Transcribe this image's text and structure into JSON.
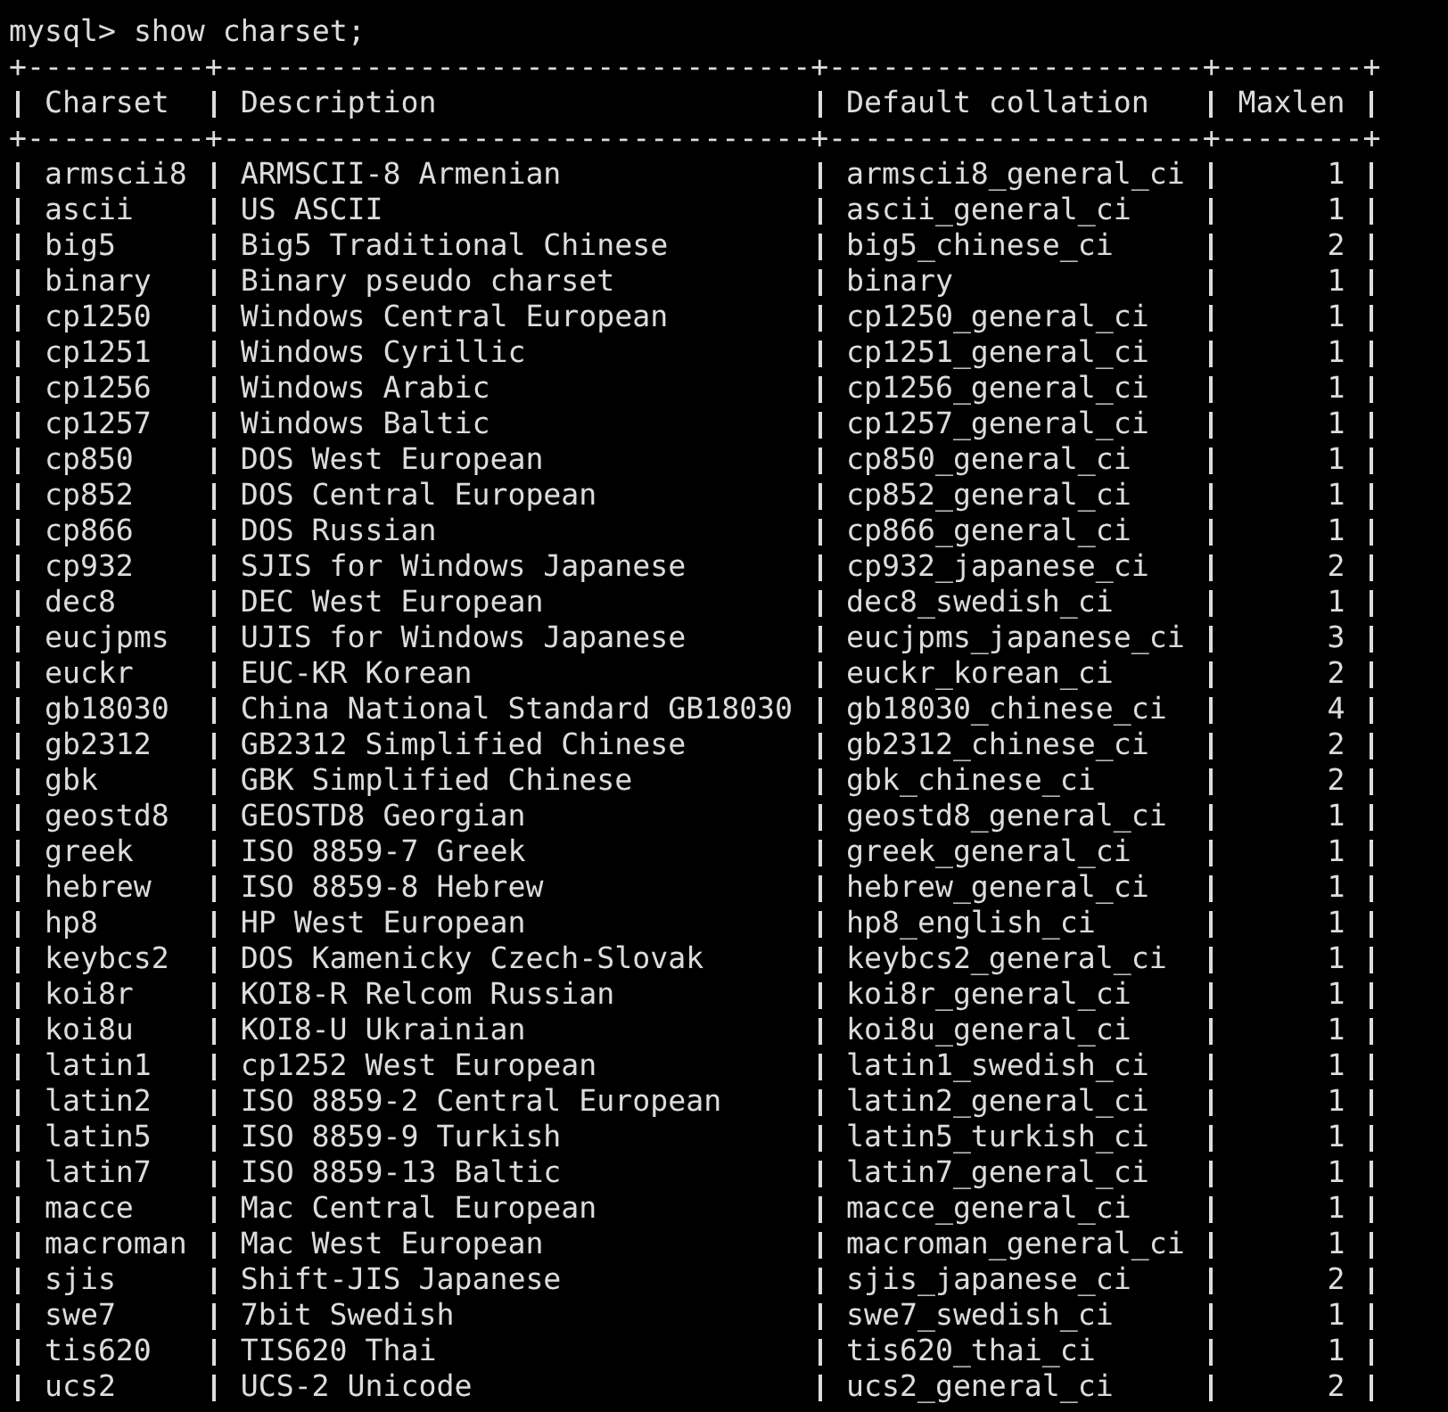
{
  "terminal": {
    "prompt": "mysql>",
    "command": "show charset;",
    "rule_top": "+----------+---------------------------------+---------------------+--------+",
    "rule_header": "+----------+---------------------------------+---------------------+--------+",
    "columns": [
      "Charset",
      "Description",
      "Default collation",
      "Maxlen"
    ],
    "rows": [
      {
        "charset": "armscii8",
        "description": "ARMSCII-8 Armenian",
        "default_collation": "armscii8_general_ci",
        "maxlen": "1"
      },
      {
        "charset": "ascii",
        "description": "US ASCII",
        "default_collation": "ascii_general_ci",
        "maxlen": "1"
      },
      {
        "charset": "big5",
        "description": "Big5 Traditional Chinese",
        "default_collation": "big5_chinese_ci",
        "maxlen": "2"
      },
      {
        "charset": "binary",
        "description": "Binary pseudo charset",
        "default_collation": "binary",
        "maxlen": "1"
      },
      {
        "charset": "cp1250",
        "description": "Windows Central European",
        "default_collation": "cp1250_general_ci",
        "maxlen": "1"
      },
      {
        "charset": "cp1251",
        "description": "Windows Cyrillic",
        "default_collation": "cp1251_general_ci",
        "maxlen": "1"
      },
      {
        "charset": "cp1256",
        "description": "Windows Arabic",
        "default_collation": "cp1256_general_ci",
        "maxlen": "1"
      },
      {
        "charset": "cp1257",
        "description": "Windows Baltic",
        "default_collation": "cp1257_general_ci",
        "maxlen": "1"
      },
      {
        "charset": "cp850",
        "description": "DOS West European",
        "default_collation": "cp850_general_ci",
        "maxlen": "1"
      },
      {
        "charset": "cp852",
        "description": "DOS Central European",
        "default_collation": "cp852_general_ci",
        "maxlen": "1"
      },
      {
        "charset": "cp866",
        "description": "DOS Russian",
        "default_collation": "cp866_general_ci",
        "maxlen": "1"
      },
      {
        "charset": "cp932",
        "description": "SJIS for Windows Japanese",
        "default_collation": "cp932_japanese_ci",
        "maxlen": "2"
      },
      {
        "charset": "dec8",
        "description": "DEC West European",
        "default_collation": "dec8_swedish_ci",
        "maxlen": "1"
      },
      {
        "charset": "eucjpms",
        "description": "UJIS for Windows Japanese",
        "default_collation": "eucjpms_japanese_ci",
        "maxlen": "3"
      },
      {
        "charset": "euckr",
        "description": "EUC-KR Korean",
        "default_collation": "euckr_korean_ci",
        "maxlen": "2"
      },
      {
        "charset": "gb18030",
        "description": "China National Standard GB18030",
        "default_collation": "gb18030_chinese_ci",
        "maxlen": "4"
      },
      {
        "charset": "gb2312",
        "description": "GB2312 Simplified Chinese",
        "default_collation": "gb2312_chinese_ci",
        "maxlen": "2"
      },
      {
        "charset": "gbk",
        "description": "GBK Simplified Chinese",
        "default_collation": "gbk_chinese_ci",
        "maxlen": "2"
      },
      {
        "charset": "geostd8",
        "description": "GEOSTD8 Georgian",
        "default_collation": "geostd8_general_ci",
        "maxlen": "1"
      },
      {
        "charset": "greek",
        "description": "ISO 8859-7 Greek",
        "default_collation": "greek_general_ci",
        "maxlen": "1"
      },
      {
        "charset": "hebrew",
        "description": "ISO 8859-8 Hebrew",
        "default_collation": "hebrew_general_ci",
        "maxlen": "1"
      },
      {
        "charset": "hp8",
        "description": "HP West European",
        "default_collation": "hp8_english_ci",
        "maxlen": "1"
      },
      {
        "charset": "keybcs2",
        "description": "DOS Kamenicky Czech-Slovak",
        "default_collation": "keybcs2_general_ci",
        "maxlen": "1"
      },
      {
        "charset": "koi8r",
        "description": "KOI8-R Relcom Russian",
        "default_collation": "koi8r_general_ci",
        "maxlen": "1"
      },
      {
        "charset": "koi8u",
        "description": "KOI8-U Ukrainian",
        "default_collation": "koi8u_general_ci",
        "maxlen": "1"
      },
      {
        "charset": "latin1",
        "description": "cp1252 West European",
        "default_collation": "latin1_swedish_ci",
        "maxlen": "1"
      },
      {
        "charset": "latin2",
        "description": "ISO 8859-2 Central European",
        "default_collation": "latin2_general_ci",
        "maxlen": "1"
      },
      {
        "charset": "latin5",
        "description": "ISO 8859-9 Turkish",
        "default_collation": "latin5_turkish_ci",
        "maxlen": "1"
      },
      {
        "charset": "latin7",
        "description": "ISO 8859-13 Baltic",
        "default_collation": "latin7_general_ci",
        "maxlen": "1"
      },
      {
        "charset": "macce",
        "description": "Mac Central European",
        "default_collation": "macce_general_ci",
        "maxlen": "1"
      },
      {
        "charset": "macroman",
        "description": "Mac West European",
        "default_collation": "macroman_general_ci",
        "maxlen": "1"
      },
      {
        "charset": "sjis",
        "description": "Shift-JIS Japanese",
        "default_collation": "sjis_japanese_ci",
        "maxlen": "2"
      },
      {
        "charset": "swe7",
        "description": "7bit Swedish",
        "default_collation": "swe7_swedish_ci",
        "maxlen": "1"
      },
      {
        "charset": "tis620",
        "description": "TIS620 Thai",
        "default_collation": "tis620_thai_ci",
        "maxlen": "1"
      },
      {
        "charset": "ucs2",
        "description": "UCS-2 Unicode",
        "default_collation": "ucs2_general_ci",
        "maxlen": "2"
      }
    ]
  }
}
